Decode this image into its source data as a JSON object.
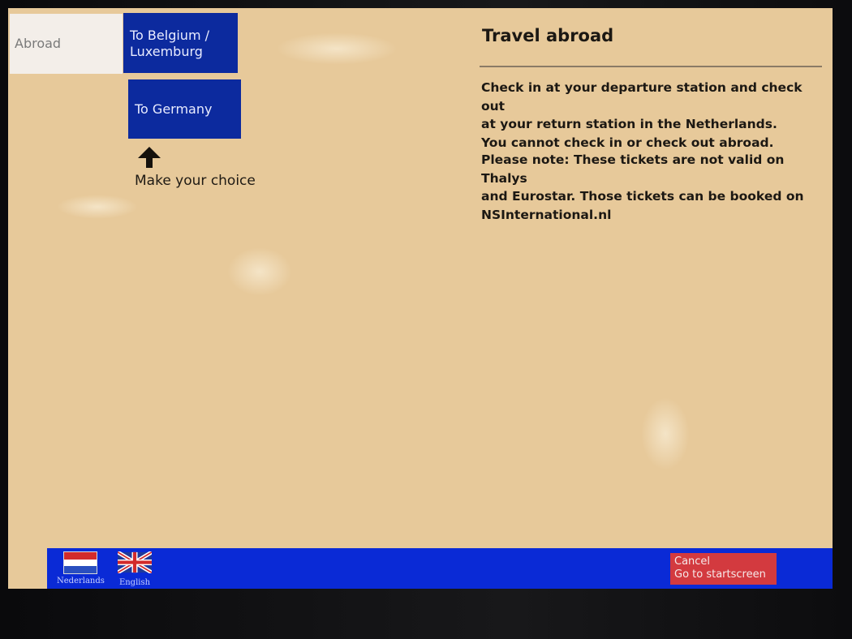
{
  "nav": {
    "active_tab": "Abroad",
    "choices": [
      {
        "line1": "To Belgium /",
        "line2": "Luxemburg"
      },
      {
        "line1": "To Germany"
      }
    ],
    "prompt": "Make your choice"
  },
  "info": {
    "title": "Travel abroad",
    "paragraph1": [
      "Check in at your departure station and check out",
      "at your return station in the Netherlands.",
      "You cannot check in or check out abroad."
    ],
    "paragraph2": [
      "Please note: These tickets are not valid on Thalys",
      "and Eurostar. Those tickets can be booked on",
      "NSInternational.nl"
    ]
  },
  "footer": {
    "languages": [
      {
        "label": "Nederlands",
        "icon": "netherlands-flag-icon"
      },
      {
        "label": "English",
        "icon": "uk-flag-icon"
      }
    ],
    "cancel": {
      "line1": "Cancel",
      "line2": "Go to startscreen"
    }
  },
  "colors": {
    "screen_bg": "#e7c99a",
    "button_blue": "#0c2a9e",
    "bar_blue": "#0a2ad6",
    "cancel_red": "#d33a3f",
    "active_tab": "#f3eee9"
  }
}
